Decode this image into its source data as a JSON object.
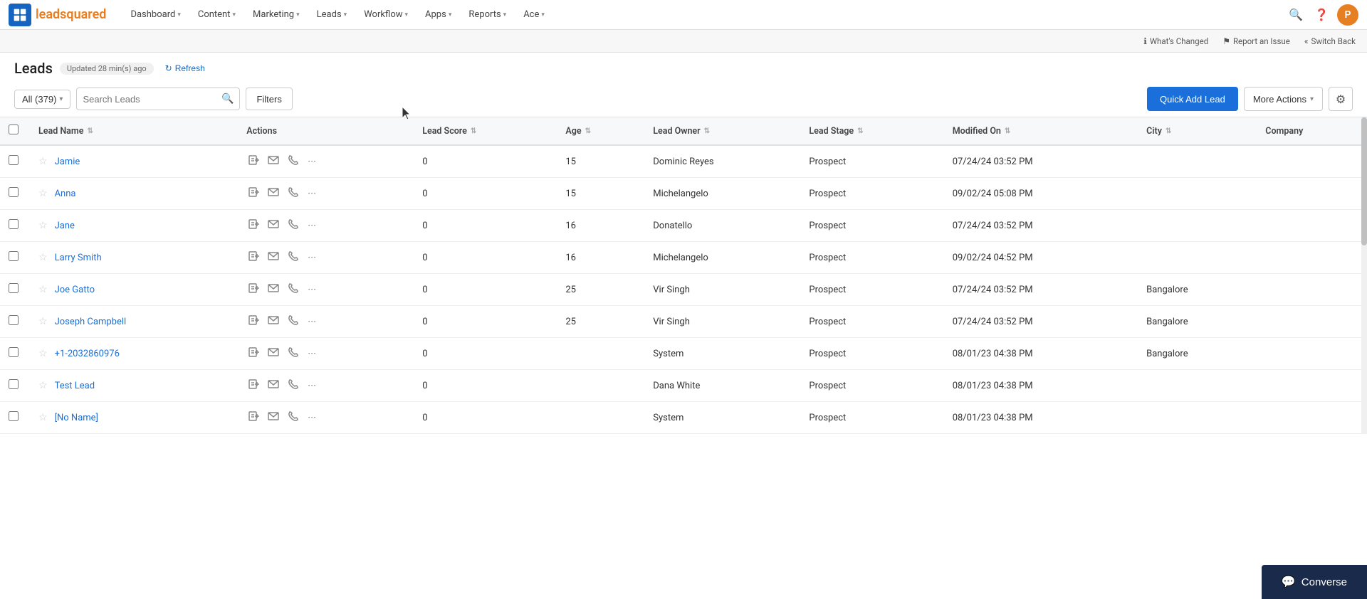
{
  "logo": {
    "icon_label": "leadsquared-logo",
    "text_part1": "lead",
    "text_part2": "squared"
  },
  "nav": {
    "items": [
      {
        "label": "Dashboard",
        "has_dropdown": true
      },
      {
        "label": "Content",
        "has_dropdown": true
      },
      {
        "label": "Marketing",
        "has_dropdown": true
      },
      {
        "label": "Leads",
        "has_dropdown": true
      },
      {
        "label": "Workflow",
        "has_dropdown": true
      },
      {
        "label": "Apps",
        "has_dropdown": true
      },
      {
        "label": "Reports",
        "has_dropdown": true
      },
      {
        "label": "Ace",
        "has_dropdown": true
      }
    ],
    "avatar_letter": "P"
  },
  "secondnav": {
    "items": [
      {
        "label": "What's Changed",
        "icon": "ℹ"
      },
      {
        "label": "Report an Issue",
        "icon": "⚑"
      },
      {
        "label": "Switch Back",
        "icon": "«"
      }
    ]
  },
  "page": {
    "title": "Leads",
    "updated_text": "Updated 28 min(s) ago",
    "refresh_label": "Refresh"
  },
  "toolbar": {
    "all_label": "All (379)",
    "search_placeholder": "Search Leads",
    "filters_label": "Filters",
    "quick_add_label": "Quick Add Lead",
    "more_actions_label": "More Actions",
    "settings_tooltip": "Settings"
  },
  "table": {
    "columns": [
      {
        "label": "Lead Name",
        "sortable": true
      },
      {
        "label": "Actions",
        "sortable": false
      },
      {
        "label": "Lead Score",
        "sortable": true
      },
      {
        "label": "Age",
        "sortable": true
      },
      {
        "label": "Lead Owner",
        "sortable": true
      },
      {
        "label": "Lead Stage",
        "sortable": true
      },
      {
        "label": "Modified On",
        "sortable": true
      },
      {
        "label": "City",
        "sortable": true
      },
      {
        "label": "Company",
        "sortable": false
      }
    ],
    "rows": [
      {
        "name": "Jamie",
        "score": 0,
        "age": 15,
        "owner": "Dominic Reyes",
        "stage": "Prospect",
        "modified": "07/24/24 03:52 PM",
        "city": "",
        "company": ""
      },
      {
        "name": "Anna",
        "score": 0,
        "age": 15,
        "owner": "Michelangelo",
        "stage": "Prospect",
        "modified": "09/02/24 05:08 PM",
        "city": "",
        "company": ""
      },
      {
        "name": "Jane",
        "score": 0,
        "age": 16,
        "owner": "Donatello",
        "stage": "Prospect",
        "modified": "07/24/24 03:52 PM",
        "city": "",
        "company": ""
      },
      {
        "name": "Larry Smith",
        "score": 0,
        "age": 16,
        "owner": "Michelangelo",
        "stage": "Prospect",
        "modified": "09/02/24 04:52 PM",
        "city": "",
        "company": ""
      },
      {
        "name": "Joe Gatto",
        "score": 0,
        "age": 25,
        "owner": "Vir Singh",
        "stage": "Prospect",
        "modified": "07/24/24 03:52 PM",
        "city": "Bangalore",
        "company": ""
      },
      {
        "name": "Joseph Campbell",
        "score": 0,
        "age": 25,
        "owner": "Vir Singh",
        "stage": "Prospect",
        "modified": "07/24/24 03:52 PM",
        "city": "Bangalore",
        "company": ""
      },
      {
        "name": "+1-2032860976",
        "score": 0,
        "age": "",
        "owner": "System",
        "stage": "Prospect",
        "modified": "08/01/23 04:38 PM",
        "city": "Bangalore",
        "company": ""
      },
      {
        "name": "Test Lead",
        "score": 0,
        "age": "",
        "owner": "Dana White",
        "stage": "Prospect",
        "modified": "08/01/23 04:38 PM",
        "city": "",
        "company": ""
      },
      {
        "name": "[No Name]",
        "score": 0,
        "age": "",
        "owner": "System",
        "stage": "Prospect",
        "modified": "08/01/23 04:38 PM",
        "city": "",
        "company": ""
      }
    ]
  },
  "converse": {
    "label": "Converse",
    "icon": "💬"
  }
}
